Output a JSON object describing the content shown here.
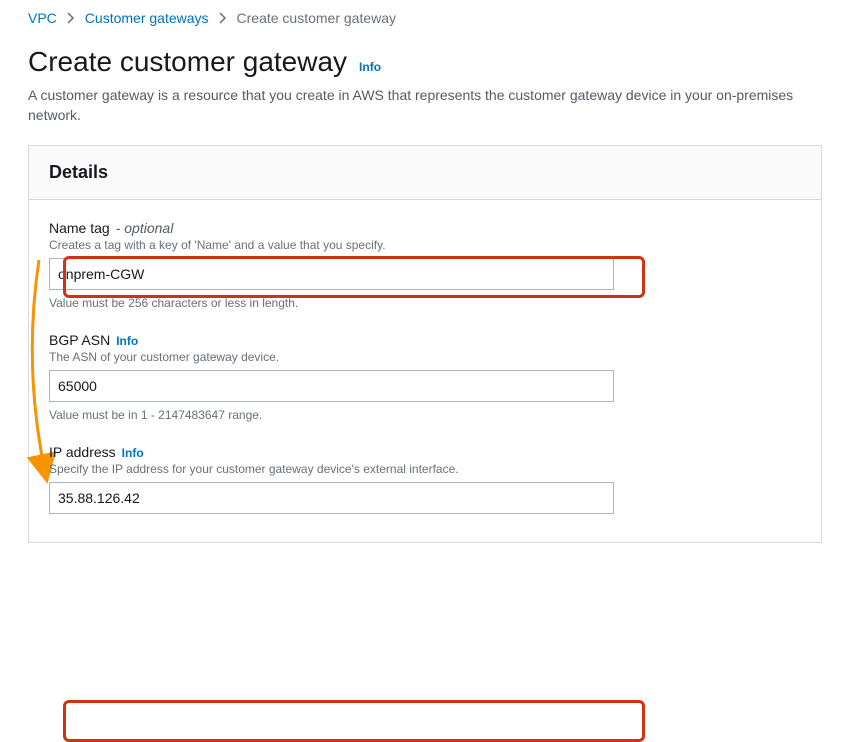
{
  "breadcrumb": {
    "root": "VPC",
    "mid": "Customer gateways",
    "current": "Create customer gateway"
  },
  "page": {
    "title": "Create customer gateway",
    "info": "Info",
    "description": "A customer gateway is a resource that you create in AWS that represents the customer gateway device in your on-premises network."
  },
  "panel": {
    "header": "Details",
    "nameTag": {
      "label": "Name tag",
      "optional": "optional",
      "subtext": "Creates a tag with a key of 'Name' and a value that you specify.",
      "value": "onprem-CGW",
      "helper": "Value must be 256 characters or less in length."
    },
    "bgpAsn": {
      "label": "BGP ASN",
      "info": "Info",
      "subtext": "The ASN of your customer gateway device.",
      "value": "65000",
      "helper": "Value must be in 1 - 2147483647 range."
    },
    "ipAddress": {
      "label": "IP address",
      "info": "Info",
      "subtext": "Specify the IP address for your customer gateway device's external interface.",
      "value": "35.88.126.42"
    }
  }
}
